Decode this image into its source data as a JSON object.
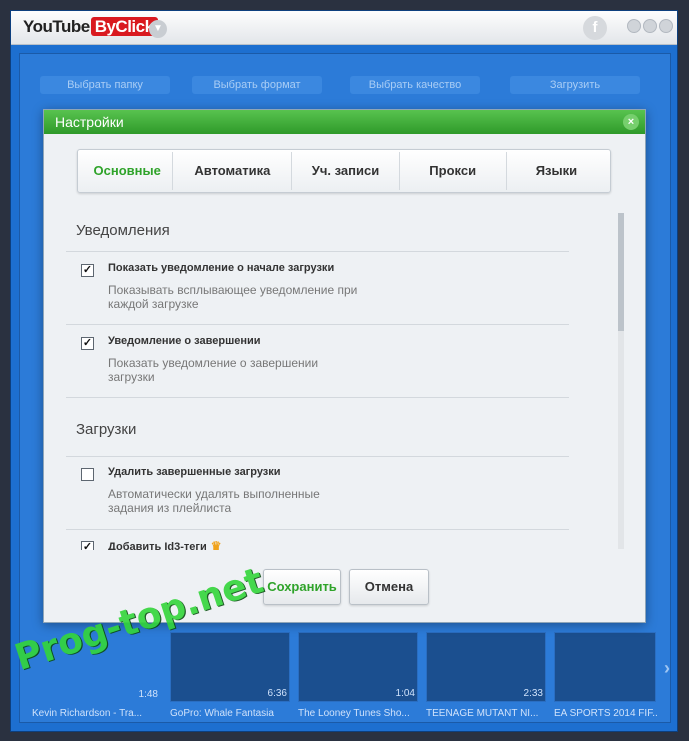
{
  "app": {
    "brand_main": "YouTube",
    "brand_accent": "ByClick",
    "brand_dropdown_icon": "chevron-down-icon",
    "facebook_icon": "f"
  },
  "background": {
    "steps": [
      "Выбрать папку",
      "Выбрать формат",
      "Выбрать качество",
      "Загрузить"
    ],
    "thumbnails": [
      {
        "title": "Kevin Richardson - Tra...",
        "duration": "1:48"
      },
      {
        "title": "GoPro: Whale Fantasia",
        "duration": "6:36"
      },
      {
        "title": "The Looney Tunes Sho...",
        "duration": "1:04"
      },
      {
        "title": "TEENAGE MUTANT NI...",
        "duration": "2:33"
      },
      {
        "title": "EA SPORTS 2014 FIF...",
        "duration": ""
      }
    ]
  },
  "dialog": {
    "title": "Настройки",
    "close_icon": "×",
    "tabs": [
      "Основные",
      "Автоматика",
      "Уч. записи",
      "Прокси",
      "Языки"
    ],
    "active_tab": 0,
    "sections": [
      {
        "title": "Уведомления",
        "options": [
          {
            "label": "Показать уведомление о начале загрузки",
            "desc": "Показывать всплывающее уведомление при каждой загрузке",
            "checked": true
          },
          {
            "label": "Уведомление о завершении",
            "desc": "Показать уведомление о завершении загрузки",
            "checked": true
          }
        ]
      },
      {
        "title": "Загрузки",
        "options": [
          {
            "label": "Удалить завершенные загрузки",
            "desc": "Автоматически удалять выполненные задания из плейлиста",
            "checked": false
          },
          {
            "label": "Добавить Id3-теги",
            "desc": "",
            "checked": true,
            "premium": true
          }
        ]
      }
    ],
    "save_label": "Сохранить",
    "cancel_label": "Отмена"
  },
  "watermark": "Prog-top.net",
  "colors": {
    "accent_green": "#2fa32a",
    "header_green": "#3daa36",
    "app_blue": "#1d6fd0",
    "brand_red": "#d9191f"
  }
}
